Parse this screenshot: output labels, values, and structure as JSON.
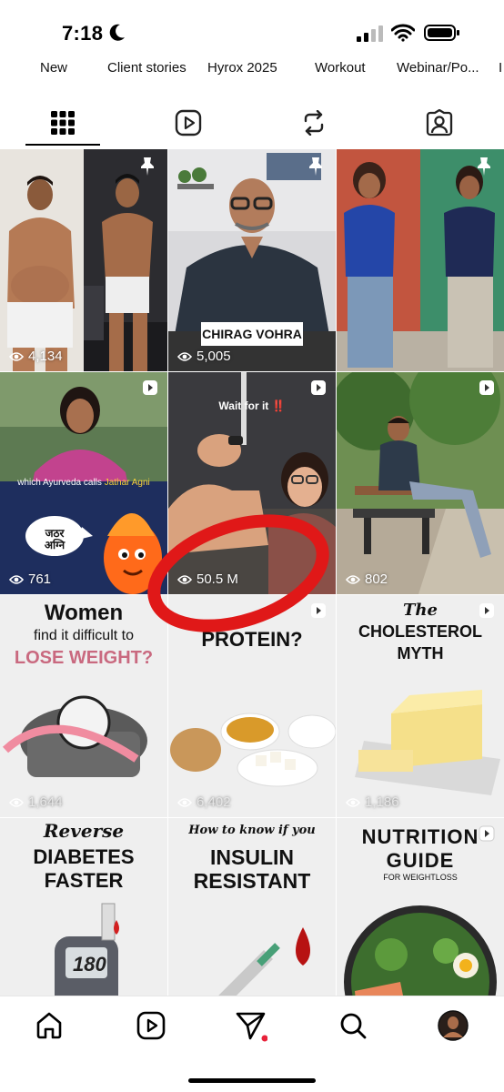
{
  "status_bar": {
    "time": "7:18"
  },
  "highlights": [
    "New",
    "Client stories",
    "Hyrox 2025",
    "Workout",
    "Webinar/Po...",
    "I"
  ],
  "tabs": [
    "grid-icon",
    "reels-icon",
    "reposts-icon",
    "tagged-icon"
  ],
  "grid": [
    {
      "views": "4,134",
      "pinned": true
    },
    {
      "views": "5,005",
      "pinned": true,
      "name_tag": "CHIRAG VOHRA"
    },
    {
      "views": "",
      "pinned": true
    },
    {
      "views": "761",
      "caption": "which Ayurveda calls",
      "caption_highlight": "Jathar Agni",
      "bubble": "जठर\nअग्नि"
    },
    {
      "views": "50.5 M",
      "top_text": "Wait for it ‼️"
    },
    {
      "views": "802"
    },
    {
      "views": "1,644",
      "title_top": "Women",
      "title_mid": "find it difficult to",
      "title_bottom": "LOSE WEIGHT?"
    },
    {
      "views": "6,402",
      "title_top": "PROTEIN?"
    },
    {
      "views": "1,186",
      "title_script": "The",
      "title_top": "CHOLESTEROL",
      "title_bottom": "MYTH"
    },
    {
      "title_script": "Reverse",
      "title_top": "DIABETES",
      "title_bottom": "FASTER",
      "meter": "180"
    },
    {
      "title_script": "How to know if you",
      "title_top": "INSULIN",
      "title_bottom": "RESISTANT"
    },
    {
      "title_top": "NUTRITION",
      "title_bottom": "GUIDE",
      "subtitle": "FOR WEIGHTLOSS"
    }
  ],
  "bottom_nav": [
    "home-icon",
    "reels-icon",
    "messages-icon",
    "search-icon",
    "profile-avatar"
  ]
}
